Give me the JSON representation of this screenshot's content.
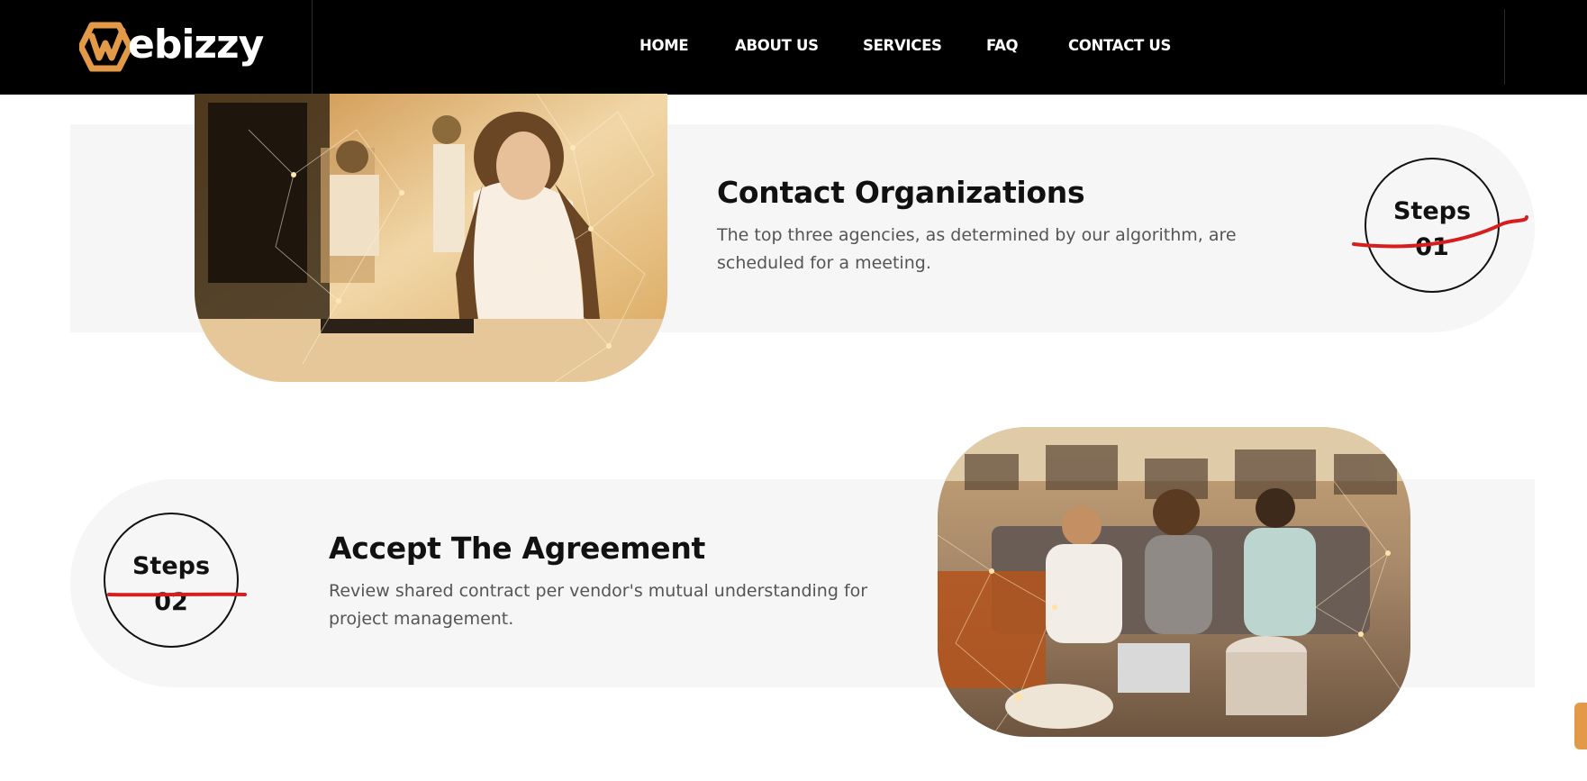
{
  "brand": {
    "logo_text": "ebizzy",
    "accent": "#e39a48"
  },
  "nav": {
    "items": [
      "HOME",
      "ABOUT US",
      "SERVICES",
      "FAQ",
      "CONTACT US"
    ]
  },
  "steps": [
    {
      "badge_label": "Steps",
      "badge_number": "01",
      "title": "Contact Organizations",
      "description": "The top three agencies, as determined by our algorithm, are scheduled for a meeting."
    },
    {
      "badge_label": "Steps",
      "badge_number": "02",
      "title": "Accept The Agreement",
      "description": "Review shared contract per vendor's mutual understanding for project management."
    }
  ],
  "colors": {
    "header_bg": "#000000",
    "panel_bg": "#f6f6f6",
    "annotation_red": "#d71e1e"
  }
}
